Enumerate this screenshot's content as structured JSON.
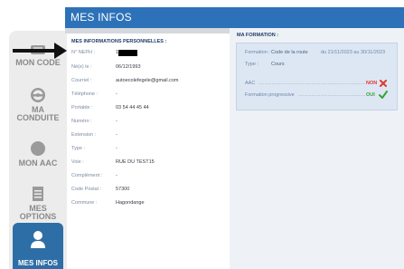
{
  "header": {
    "title": "MES INFOS"
  },
  "sidebar": {
    "items": [
      {
        "label_lines": [
          "MON CODE"
        ],
        "icon": "code-icon"
      },
      {
        "label_lines": [
          "MA",
          "CONDUITE"
        ],
        "icon": "steering-wheel-icon"
      },
      {
        "label_lines": [
          "MON AAC"
        ],
        "icon": "aac-icon"
      },
      {
        "label_lines": [
          "MES",
          "OPTIONS"
        ],
        "icon": "document-icon"
      },
      {
        "label_lines": [
          "MES INFOS"
        ],
        "icon": "user-icon",
        "active": true
      }
    ]
  },
  "personal": {
    "title": "MES INFORMATIONS PERSONNELLES :",
    "rows": [
      {
        "key": "N° NEPH :",
        "value": "1"
      },
      {
        "key": "Né(e) le :",
        "value": "06/12/1993"
      },
      {
        "key": "Courriel :",
        "value": "autoecolefegele@gmail.com"
      },
      {
        "key": "Téléphone :",
        "value": "-"
      },
      {
        "key": "Portable :",
        "value": "03 54 44 45 44"
      },
      {
        "key": "Numéro :",
        "value": "-"
      },
      {
        "key": "Extension :",
        "value": "-"
      },
      {
        "key": "Type :",
        "value": "-"
      },
      {
        "key": "Voie :",
        "value": "RUE DU TEST15"
      },
      {
        "key": "Complément :",
        "value": "-"
      },
      {
        "key": "Code Postal :",
        "value": "57300"
      },
      {
        "key": "Commune :",
        "value": "Hagondange"
      }
    ]
  },
  "formation": {
    "title": "MA FORMATION :",
    "formation_label": "Formation :",
    "formation_value": "Code de la route",
    "dates": "du 21/11/2023 au 30/11/2023",
    "type_label": "Type :",
    "type_value": "Cours",
    "aac_label": "AAC",
    "aac_value": "NON",
    "progressive_label": "Formation progressive",
    "progressive_value": "OUI"
  },
  "colors": {
    "accent": "#2d72b8",
    "no_red": "#e03a2f",
    "yes_green": "#3aa13a"
  }
}
